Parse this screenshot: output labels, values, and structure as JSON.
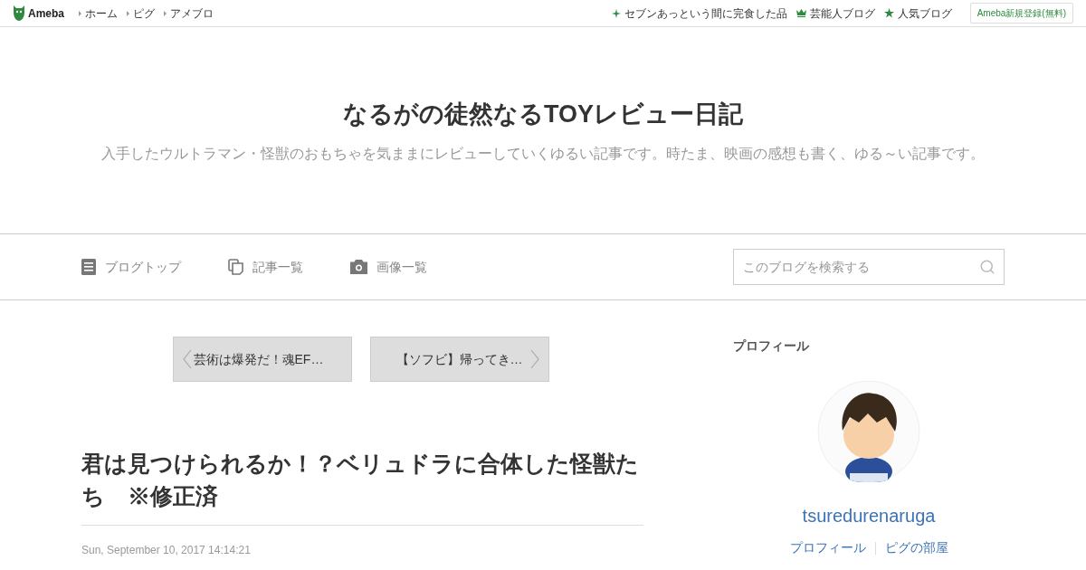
{
  "topbar": {
    "logo": "Ameba",
    "links": [
      "ホーム",
      "ピグ",
      "アメブロ"
    ],
    "right_links": [
      {
        "kind": "sparkle",
        "label": "セブンあっという間に完食した品"
      },
      {
        "kind": "crown",
        "label": "芸能人ブログ"
      },
      {
        "kind": "star",
        "label": "人気ブログ"
      }
    ],
    "signup": "Ameba新規登録(無料)"
  },
  "header": {
    "title": "なるがの徒然なるTOYレビュー日記",
    "description": "入手したウルトラマン・怪獣のおもちゃを気ままにレビューしていくゆるい記事です。時たま、映画の感想も書く、ゆる～い記事です。"
  },
  "nav": {
    "items": [
      {
        "kind": "doc",
        "label": "ブログトップ"
      },
      {
        "kind": "copy",
        "label": "記事一覧"
      },
      {
        "kind": "camera",
        "label": "画像一覧"
      }
    ],
    "search": {
      "placeholder": "このブログを検索する"
    }
  },
  "pager": {
    "prev": "芸術は爆発だ！魂EF…",
    "next": "【ソフビ】帰ってき…"
  },
  "article": {
    "title": "君は見つけられるか！？ベリュドラに合体した怪獣たち　※修正済",
    "date": "Sun, September 10, 2017 14:14:21"
  },
  "profile": {
    "heading": "プロフィール",
    "avatar": {
      "kind": "picture"
    },
    "name": "tsuredurenaruga",
    "links": [
      "プロフィール",
      "ピグの部屋"
    ]
  }
}
